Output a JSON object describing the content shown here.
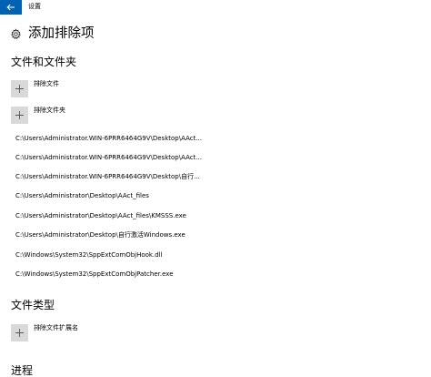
{
  "window": {
    "title": "设置"
  },
  "page": {
    "title": "添加排除项"
  },
  "files_section": {
    "title": "文件和文件夹",
    "add_file_label": "排除文件",
    "add_folder_label": "排除文件夹",
    "items": [
      "C:\\Users\\Administrator.WIN-6PRR6464G9V\\Desktop\\AAct...",
      "C:\\Users\\Administrator.WIN-6PRR6464G9V\\Desktop\\AAct...",
      "C:\\Users\\Administrator.WIN-6PRR6464G9V\\Desktop\\自行...",
      "C:\\Users\\Administrator\\Desktop\\AAct_files",
      "C:\\Users\\Administrator\\Desktop\\AAct_files\\KMSSS.exe",
      "C:\\Users\\Administrator\\Desktop\\自行激活Windows.exe",
      "C:\\Windows\\System32\\SppExtComObjHook.dll",
      "C:\\Windows\\System32\\SppExtComObjPatcher.exe"
    ]
  },
  "types_section": {
    "title": "文件类型",
    "add_extension_label": "排除文件扩展名"
  },
  "next_section": {
    "title": "进程"
  },
  "colors": {
    "accent": "#0063b1",
    "tile": "#d9d9d9"
  },
  "icons": {
    "back": "back-arrow-icon",
    "settings": "gear-icon",
    "add": "plus-icon"
  }
}
